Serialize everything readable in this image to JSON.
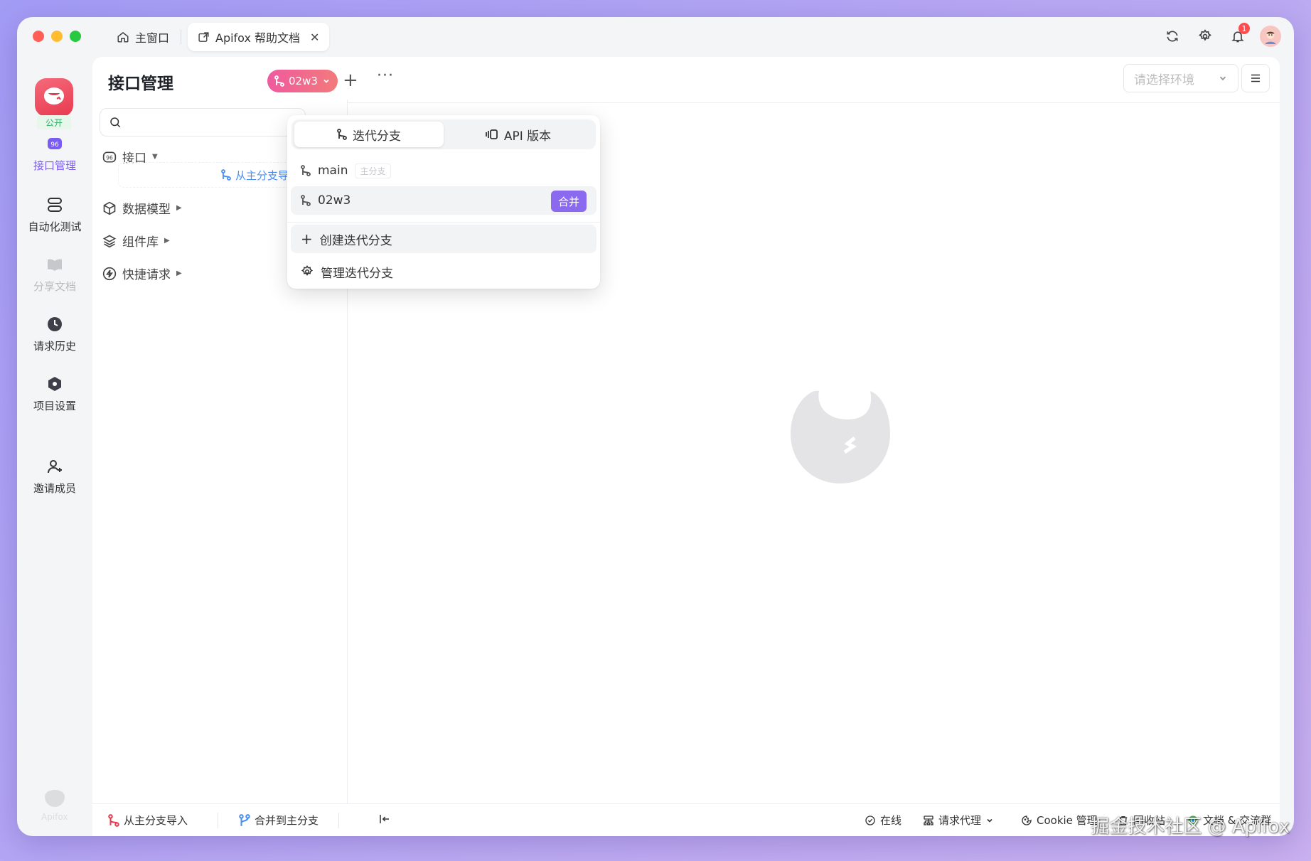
{
  "titlebar": {
    "tabs": [
      {
        "label": "主窗口",
        "icon": "home-icon"
      },
      {
        "label": "Apifox 帮助文档",
        "icon": "external-link-icon",
        "close": "✕"
      }
    ],
    "notification_count": "1"
  },
  "rail": {
    "public_tag": "公开",
    "items": [
      {
        "label": "接口管理",
        "icon": "api-icon",
        "active": true
      },
      {
        "label": "自动化测试",
        "icon": "stack-icon"
      },
      {
        "label": "分享文档",
        "icon": "book-icon"
      },
      {
        "label": "请求历史",
        "icon": "clock-icon"
      },
      {
        "label": "项目设置",
        "icon": "hexagon-icon"
      },
      {
        "label": "邀请成员",
        "icon": "add-user-icon"
      }
    ],
    "bottom_label": "Apifox"
  },
  "panel": {
    "title": "接口管理",
    "branch": "02w3",
    "tree": [
      {
        "label": "接口",
        "icon": "api-icon"
      },
      {
        "label": "数据模型",
        "icon": "cube-icon"
      },
      {
        "label": "组件库",
        "icon": "layers-icon"
      },
      {
        "label": "快捷请求",
        "icon": "bolt-icon"
      }
    ],
    "import_link": "从主分支导入",
    "env_placeholder": "请选择环境"
  },
  "dropdown": {
    "tabs": [
      "迭代分支",
      "API 版本"
    ],
    "branches": [
      {
        "name": "main",
        "tag": "主分支"
      },
      {
        "name": "02w3",
        "action": "合并"
      }
    ],
    "create": "创建迭代分支",
    "manage": "管理迭代分支"
  },
  "bottom_bar": {
    "import": "从主分支导入",
    "merge": "合并到主分支",
    "online": "在线",
    "proxy": "请求代理",
    "cookie": "Cookie 管理",
    "recycle": "回收站",
    "docs": "文档 & 交流群"
  },
  "watermark": "掘金技术社区 @ Apifox",
  "colors": {
    "accent": "#7b5cf0",
    "branch_pill_start": "#ef5aa0",
    "branch_pill_end": "#f27a7a",
    "merge": "#8c6af0"
  }
}
